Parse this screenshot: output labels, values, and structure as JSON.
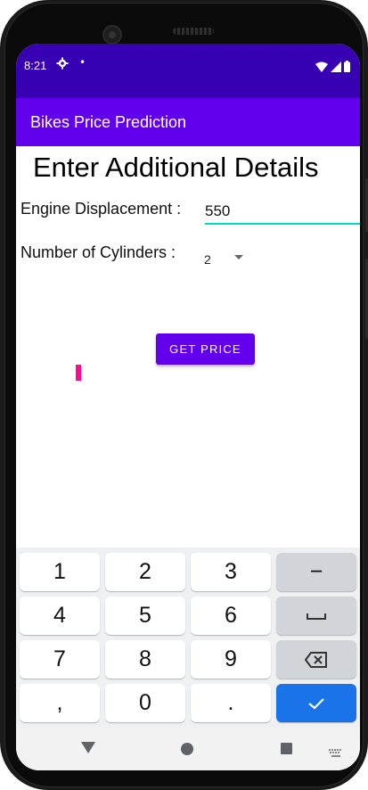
{
  "status_bar": {
    "time": "8:21",
    "gear_icon": "settings-gear",
    "dot": "•"
  },
  "app_bar": {
    "title": "Bikes Price Prediction"
  },
  "form": {
    "heading": "Enter Additional Details",
    "engine_label": "Engine Displacement :",
    "engine_value": "550",
    "cylinders_label": "Number of Cylinders :",
    "cylinders_value": "2",
    "button_label": "GET PRICE"
  },
  "keyboard": {
    "rows": [
      [
        "1",
        "2",
        "3",
        "−"
      ],
      [
        "4",
        "5",
        "6",
        "␣"
      ],
      [
        "7",
        "8",
        "9",
        "⌫"
      ],
      [
        ",",
        "0",
        ".",
        "✓"
      ]
    ]
  },
  "colors": {
    "status_bar": "#3700b3",
    "primary": "#6200ee",
    "accent": "#03dac5",
    "result_marker": "#ff0a8c",
    "done_key": "#1a73e8"
  }
}
